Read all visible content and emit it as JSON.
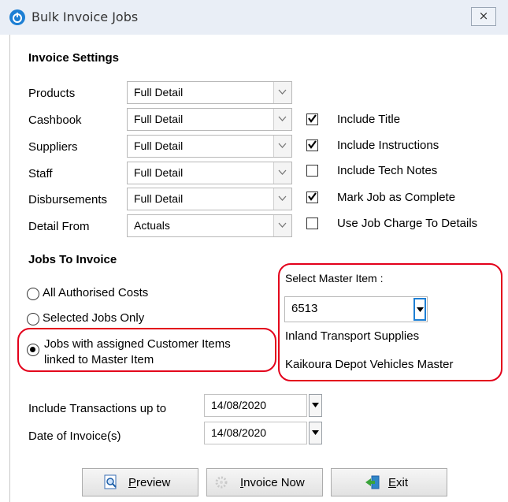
{
  "window": {
    "title": "Bulk Invoice Jobs",
    "close_glyph": "⨯"
  },
  "invoice_settings": {
    "heading": "Invoice Settings",
    "rows": [
      {
        "label": "Products",
        "value": "Full Detail"
      },
      {
        "label": "Cashbook",
        "value": "Full Detail"
      },
      {
        "label": "Suppliers",
        "value": "Full Detail"
      },
      {
        "label": "Staff",
        "value": "Full Detail"
      },
      {
        "label": "Disbursements",
        "value": "Full Detail"
      },
      {
        "label": "Detail From",
        "value": "Actuals"
      }
    ],
    "options": [
      {
        "label": "Include Title",
        "checked": true
      },
      {
        "label": "Include Instructions",
        "checked": true
      },
      {
        "label": "Include Tech Notes",
        "checked": false
      },
      {
        "label": "Mark Job as Complete",
        "checked": true
      },
      {
        "label": "Use Job Charge To Details",
        "checked": false
      }
    ]
  },
  "jobs_to_invoice": {
    "heading": "Jobs To Invoice",
    "radios": [
      {
        "label": "All Authorised Costs",
        "selected": false
      },
      {
        "label": "Selected Jobs Only",
        "selected": false
      },
      {
        "label_line1": "Jobs with assigned Customer Items",
        "label_line2": "linked to Master Item",
        "selected": true
      }
    ]
  },
  "master_item": {
    "label": "Select Master Item :",
    "value": "6513",
    "supplier": "Inland Transport Supplies",
    "description": "Kaikoura Depot Vehicles Master"
  },
  "dates": {
    "include_label": "Include Transactions up to",
    "include_value": "14/08/2020",
    "invoice_label": "Date of Invoice(s)",
    "invoice_value": "14/08/2020"
  },
  "buttons": {
    "preview_prefix": "",
    "preview_mnemonic": "P",
    "preview_rest": "review",
    "invoice_mnemonic": "I",
    "invoice_rest": "nvoice Now",
    "exit_mnemonic": "E",
    "exit_rest": "xit"
  },
  "colors": {
    "highlight": "#e3001b",
    "accent": "#1d7fd4"
  },
  "icons": [
    "app-logo-icon",
    "close-icon",
    "chevron-down-icon",
    "checkmark-icon",
    "magnifier-icon",
    "gear-icon",
    "exit-door-icon"
  ]
}
